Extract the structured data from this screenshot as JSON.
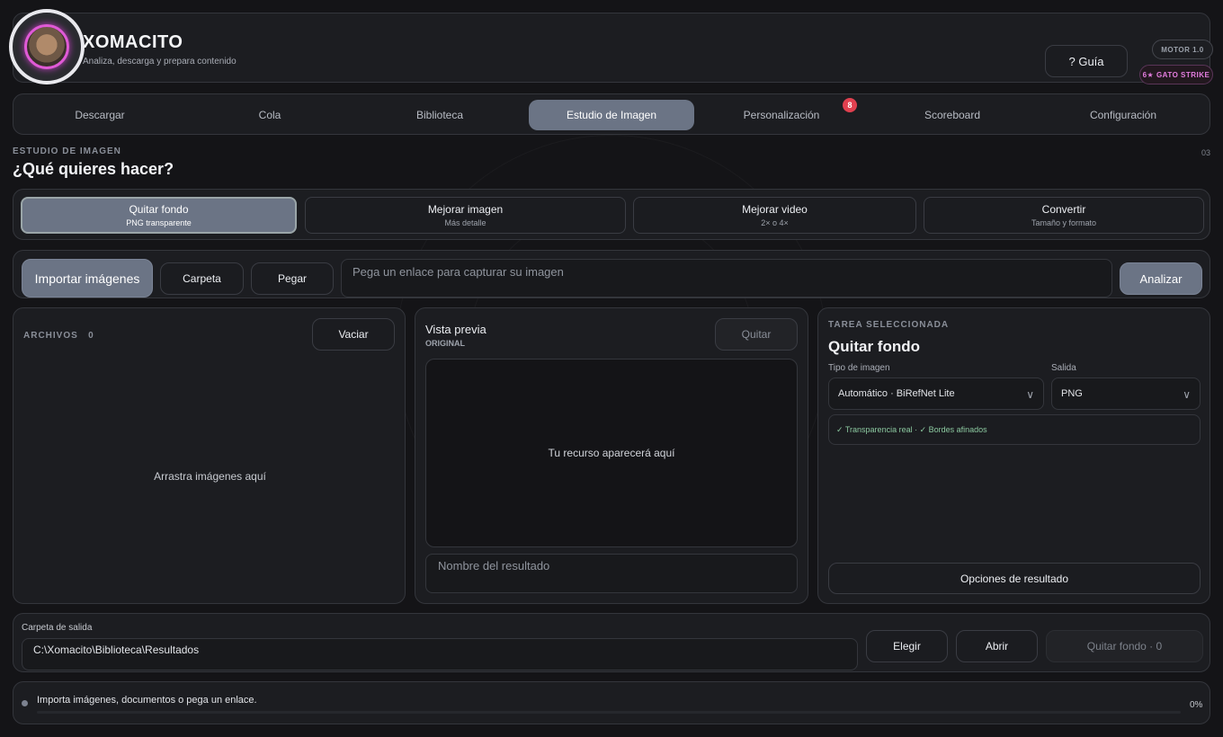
{
  "header": {
    "title": "XOMACITO",
    "subtitle": "Analiza, descarga y prepara contenido",
    "guide_label": "? Guía",
    "motor_label": "MOTOR 1.0",
    "strike_label": "6★ GATO STRIKE"
  },
  "tabs": [
    {
      "label": "Descargar"
    },
    {
      "label": "Cola"
    },
    {
      "label": "Biblioteca"
    },
    {
      "label": "Estudio de Imagen"
    },
    {
      "label": "Personalización",
      "badge": "8"
    },
    {
      "label": "Scoreboard"
    },
    {
      "label": "Configuración"
    }
  ],
  "section": {
    "kicker": "ESTUDIO DE IMAGEN",
    "title": "¿Qué quieres hacer?",
    "number": "03"
  },
  "tasks": [
    {
      "title": "Quitar fondo",
      "subtitle": "PNG transparente"
    },
    {
      "title": "Mejorar imagen",
      "subtitle": "Más detalle"
    },
    {
      "title": "Mejorar video",
      "subtitle": "2× o 4×"
    },
    {
      "title": "Convertir",
      "subtitle": "Tamaño y formato"
    }
  ],
  "import": {
    "import_label": "Importar imágenes",
    "folder_label": "Carpeta",
    "paste_label": "Pegar",
    "url_placeholder": "Pega un enlace para capturar su imagen",
    "analyze_label": "Analizar"
  },
  "files": {
    "title": "ARCHIVOS",
    "count": "0",
    "clear_label": "Vaciar",
    "empty_text": "Arrastra imágenes aquí"
  },
  "preview": {
    "title": "Vista previa",
    "subtitle": "ORIGINAL",
    "remove_label": "Quitar",
    "empty_text": "Tu recurso aparecerá aquí",
    "name_placeholder": "Nombre del resultado"
  },
  "task_panel": {
    "kicker": "TAREA SELECCIONADA",
    "title": "Quitar fondo",
    "type_label": "Tipo de imagen",
    "type_value": "Automático · BiRefNet Lite",
    "output_label": "Salida",
    "output_value": "PNG",
    "features": "✓ Transparencia real · ✓ Bordes afinados",
    "options_label": "Opciones de resultado"
  },
  "output": {
    "label": "Carpeta de salida",
    "path": "C:\\Xomacito\\Biblioteca\\Resultados",
    "choose_label": "Elegir",
    "open_label": "Abrir",
    "run_label": "Quitar fondo · 0"
  },
  "status": {
    "text": "Importa imágenes, documentos o pega un enlace.",
    "progress_label": "0%",
    "progress": 0
  },
  "colors": {
    "accent": "#6b7485",
    "badge": "#e0404f",
    "strike": "#e57ee0",
    "feature_green": "#8cc9a0"
  }
}
